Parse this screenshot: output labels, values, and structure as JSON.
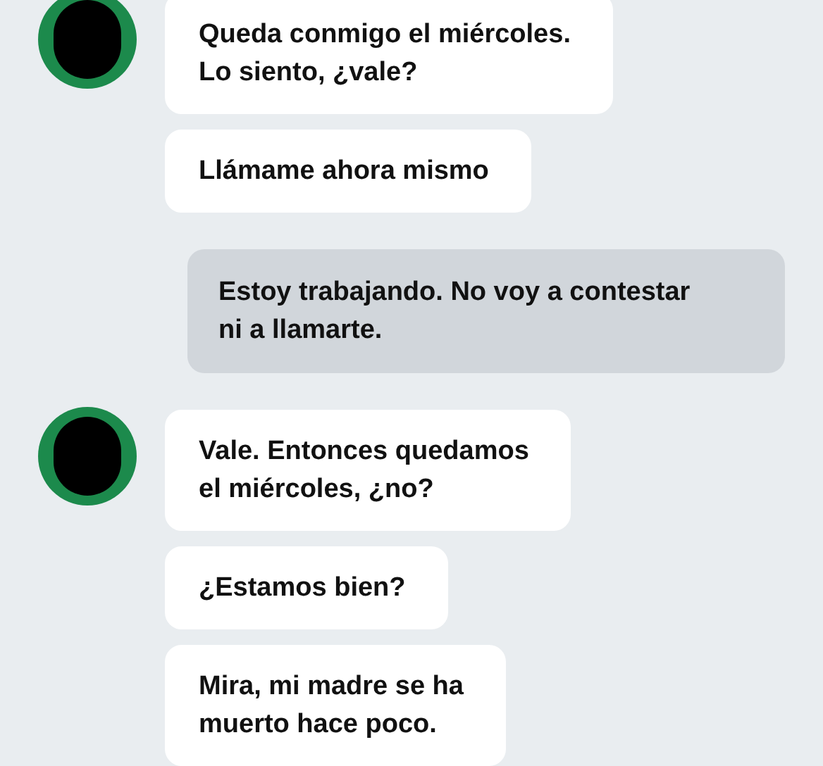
{
  "messages": [
    {
      "kind": "received",
      "avatar": true,
      "text": "Queda conmigo el miércoles.\nLo siento, ¿vale?"
    },
    {
      "kind": "received",
      "avatar": false,
      "text": "Llámame ahora mismo"
    },
    {
      "kind": "sent",
      "text": "Estoy trabajando. No voy a contestar\nni a llamarte."
    },
    {
      "kind": "received",
      "avatar": true,
      "text": "Vale. Entonces quedamos\nel miércoles, ¿no?"
    },
    {
      "kind": "received",
      "avatar": false,
      "text": "¿Estamos bien?"
    },
    {
      "kind": "received",
      "avatar": false,
      "text": "Mira, mi madre se ha\nmuerto hace poco."
    }
  ]
}
